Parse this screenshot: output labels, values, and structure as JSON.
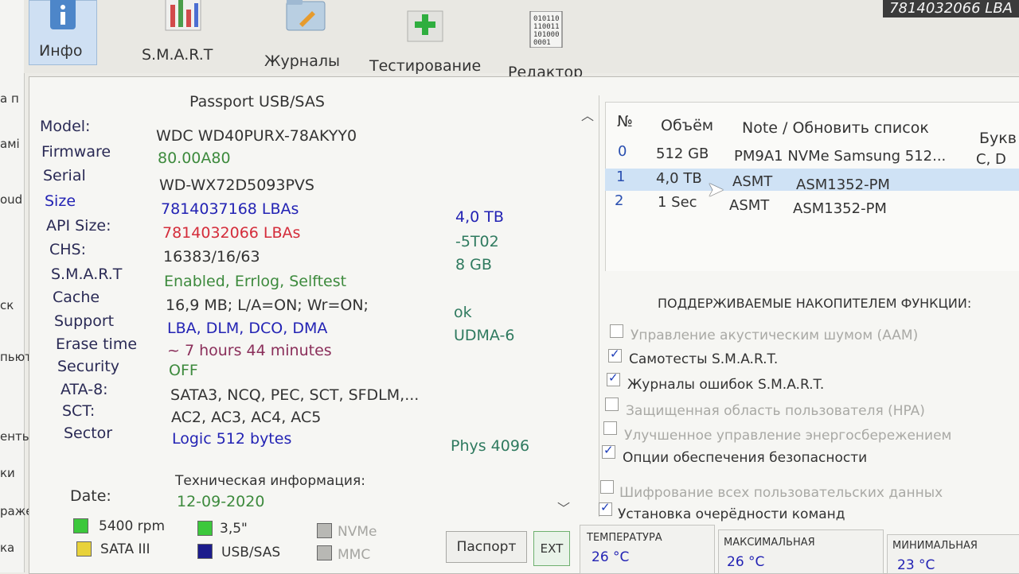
{
  "left_strip": [
    "а п",
    "амі",
    "oud",
    "ск",
    "пьюте",
    "енты",
    "ки",
    "ражения",
    "ка"
  ],
  "toolbar": {
    "info": "Инфо",
    "smart": "S.M.A.R.T",
    "logs": "Журналы",
    "testing": "Тестирование",
    "editor": "Редактор"
  },
  "corner_readout": "7814032066 LBA",
  "passport": {
    "title": "Passport USB/SAS",
    "fields": [
      {
        "label": "Model:",
        "value": "WDC WD40PURX-78AKYY0",
        "extra": ""
      },
      {
        "label": "Firmware",
        "value": "80.00A80",
        "extra": ""
      },
      {
        "label": "Serial",
        "value": "WD-WX72D5093PVS",
        "extra": ""
      },
      {
        "label": "Size",
        "value": "7814037168 LBAs",
        "extra": "4,0 TB"
      },
      {
        "label": "API Size:",
        "value": "7814032066 LBAs",
        "extra": "-5T02"
      },
      {
        "label": "CHS:",
        "value": "16383/16/63",
        "extra": "8 GB"
      },
      {
        "label": "S.M.A.R.T",
        "value": "Enabled, Errlog, Selftest",
        "extra": ""
      },
      {
        "label": "Cache",
        "value": "16,9 MB; L/A=ON; Wr=ON;",
        "extra": "ok"
      },
      {
        "label": "Support",
        "value": "LBA, DLM, DCO, DMA",
        "extra": "UDMA-6"
      },
      {
        "label": "Erase time",
        "value": "~ 7 hours 44 minutes",
        "extra": ""
      },
      {
        "label": "Security",
        "value": "OFF",
        "extra": ""
      },
      {
        "label": "ATA-8:",
        "value": "SATA3, NCQ, PEC, SCT, SFDLM,...",
        "extra": ""
      },
      {
        "label": "SCT:",
        "value": "AC2, AC3, AC4, AC5",
        "extra": ""
      },
      {
        "label": "Sector",
        "value": "Logic 512 bytes",
        "extra": "Phys 4096"
      }
    ],
    "tech_info": "Техническая информация:",
    "date_label": "Date:",
    "date_value": "12-09-2020"
  },
  "drives": {
    "headers": [
      "№",
      "Объём",
      "Note / Обновить список",
      "Букв"
    ],
    "rows": [
      {
        "num": "0",
        "size": "512 GB",
        "note": "PM9A1 NVMe Samsung 512...",
        "note2": "",
        "letters": "C, D"
      },
      {
        "num": "1",
        "size": "4,0 TB",
        "note": "ASMT",
        "note2": "ASM1352-PM",
        "letters": ""
      },
      {
        "num": "2",
        "size": "1 Sec",
        "note": "ASMT",
        "note2": "ASM1352-PM",
        "letters": ""
      }
    ]
  },
  "features": {
    "title": "ПОДДЕРЖИВАЕМЫЕ НАКОПИТЕЛЕМ ФУНКЦИИ:",
    "items": [
      {
        "label": "Управление акустическим шумом (AAM)",
        "checked": false
      },
      {
        "label": "Самотесты S.M.A.R.T.",
        "checked": true
      },
      {
        "label": "Журналы ошибок S.M.A.R.T.",
        "checked": true
      },
      {
        "label": "Защищенная область пользователя (HPA)",
        "checked": false
      },
      {
        "label": "Улучшенное управление энергосбережением",
        "checked": false
      },
      {
        "label": "Опции обеспечения безопасности",
        "checked": true
      },
      {
        "label": "Шифрование всех пользовательских данных",
        "checked": false
      },
      {
        "label": "Установка очерёдности команд",
        "checked": true
      }
    ]
  },
  "legend": {
    "rpm": "5400 rpm",
    "form": "3,5\"",
    "nvme": "NVMe",
    "sata": "SATA III",
    "usb": "USB/SAS",
    "mmc": "MMC",
    "colors": {
      "green": "#3cc83c",
      "yellow": "#e8d23a",
      "navy": "#1c1c8c",
      "gray": "#b8b8b4"
    }
  },
  "buttons": {
    "passport": "Паспорт",
    "ext": "EXT"
  },
  "temps": [
    {
      "label": "ТЕМПЕРАТУРА",
      "value": "26 °C"
    },
    {
      "label": "МАКСИМАЛЬНАЯ",
      "value": "26 °C"
    },
    {
      "label": "МИНИМАЛЬНАЯ",
      "value": "23 °C"
    }
  ]
}
